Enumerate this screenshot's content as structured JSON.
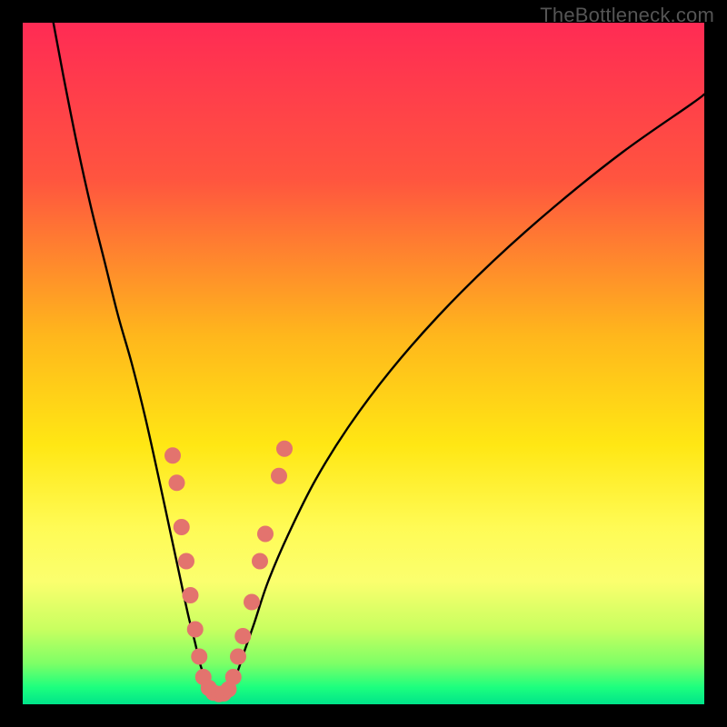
{
  "watermark": "TheBottleneck.com",
  "chart_data": {
    "type": "line",
    "title": "",
    "xlabel": "",
    "ylabel": "",
    "xlim": [
      0,
      100
    ],
    "ylim": [
      0,
      100
    ],
    "grid": false,
    "background_gradient": {
      "stops": [
        {
          "offset": 0.0,
          "color": "#ff2b54"
        },
        {
          "offset": 0.23,
          "color": "#ff553f"
        },
        {
          "offset": 0.46,
          "color": "#ffb71c"
        },
        {
          "offset": 0.62,
          "color": "#ffe714"
        },
        {
          "offset": 0.74,
          "color": "#fffb55"
        },
        {
          "offset": 0.82,
          "color": "#fbff6e"
        },
        {
          "offset": 0.89,
          "color": "#c8ff60"
        },
        {
          "offset": 0.94,
          "color": "#7eff66"
        },
        {
          "offset": 0.975,
          "color": "#1dff7e"
        },
        {
          "offset": 1.0,
          "color": "#00e48a"
        }
      ]
    },
    "series": [
      {
        "name": "curve-left",
        "x": [
          4.5,
          6,
          8,
          10,
          12,
          14,
          16,
          18,
          20,
          21.5,
          23,
          24.3,
          25.3,
          26.0,
          26.7,
          27.3,
          27.8
        ],
        "y": [
          100,
          92,
          82,
          73,
          65,
          57,
          50,
          42,
          33,
          26,
          19,
          13,
          9,
          6,
          4,
          2.5,
          1.8
        ]
      },
      {
        "name": "curve-right",
        "x": [
          30.0,
          30.8,
          31.6,
          32.6,
          34,
          36,
          39,
          43,
          48,
          54,
          61,
          69,
          78,
          88,
          98,
          100
        ],
        "y": [
          1.8,
          3,
          5,
          8,
          12,
          18,
          25,
          33,
          41,
          49,
          57,
          65,
          73,
          81,
          88,
          89.5
        ]
      },
      {
        "name": "curve-bottom",
        "x": [
          27.8,
          28.2,
          28.6,
          29.0,
          29.4,
          29.8,
          30.0
        ],
        "y": [
          1.8,
          1.5,
          1.4,
          1.4,
          1.5,
          1.7,
          1.8
        ]
      }
    ],
    "markers": {
      "color": "#e3736e",
      "radius": 9,
      "points": [
        {
          "x": 22.0,
          "y": 36.5
        },
        {
          "x": 22.6,
          "y": 32.5
        },
        {
          "x": 23.3,
          "y": 26.0
        },
        {
          "x": 24.0,
          "y": 21.0
        },
        {
          "x": 24.6,
          "y": 16.0
        },
        {
          "x": 25.3,
          "y": 11.0
        },
        {
          "x": 25.9,
          "y": 7.0
        },
        {
          "x": 26.5,
          "y": 4.0
        },
        {
          "x": 27.3,
          "y": 2.4
        },
        {
          "x": 28.0,
          "y": 1.7
        },
        {
          "x": 28.8,
          "y": 1.5
        },
        {
          "x": 29.5,
          "y": 1.6
        },
        {
          "x": 30.2,
          "y": 2.2
        },
        {
          "x": 30.9,
          "y": 4.0
        },
        {
          "x": 31.6,
          "y": 7.0
        },
        {
          "x": 32.3,
          "y": 10.0
        },
        {
          "x": 33.6,
          "y": 15.0
        },
        {
          "x": 34.8,
          "y": 21.0
        },
        {
          "x": 35.6,
          "y": 25.0
        },
        {
          "x": 37.6,
          "y": 33.5
        },
        {
          "x": 38.4,
          "y": 37.5
        }
      ]
    }
  }
}
